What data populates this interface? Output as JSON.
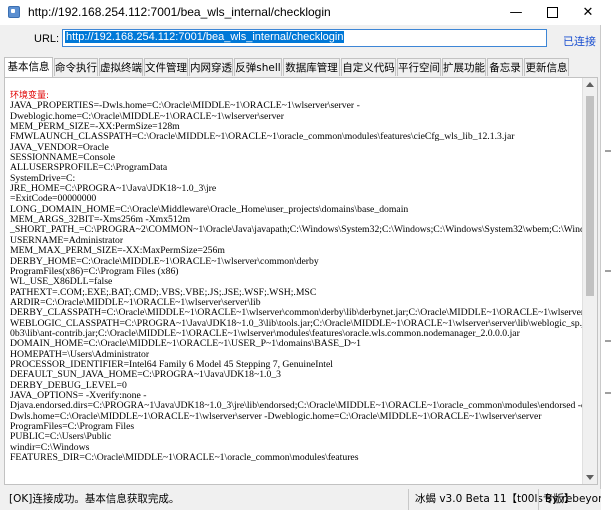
{
  "window": {
    "title": "http://192.168.254.112:7001/bea_wls_internal/checklogin",
    "minimize_glyph": "—",
    "close_glyph": "✕"
  },
  "url_bar": {
    "label": "URL:",
    "value": "http://192.168.254.112:7001/bea_wls_internal/checklogin",
    "status": "已连接"
  },
  "tabs": [
    {
      "label": "基本信息",
      "active": true
    },
    {
      "label": "命令执行",
      "active": false
    },
    {
      "label": "虚拟终端",
      "active": false
    },
    {
      "label": "文件管理",
      "active": false
    },
    {
      "label": "内网穿透",
      "active": false
    },
    {
      "label": "反弹shell",
      "active": false
    },
    {
      "label": "数据库管理",
      "active": false
    },
    {
      "label": "自定义代码",
      "active": false
    },
    {
      "label": "平行空间",
      "active": false
    },
    {
      "label": "扩展功能",
      "active": false
    },
    {
      "label": "备忘录",
      "active": false
    },
    {
      "label": "更新信息",
      "active": false
    }
  ],
  "content": {
    "section_header": "环境变量:",
    "lines": [
      "JAVA_PROPERTIES=-Dwls.home=C:\\Oracle\\MIDDLE~1\\ORACLE~1\\wlserver\\server -",
      "Dweblogic.home=C:\\Oracle\\MIDDLE~1\\ORACLE~1\\wlserver\\server",
      "MEM_PERM_SIZE=-XX:PermSize=128m",
      "FMWLAUNCH_CLASSPATH=C:\\Oracle\\MIDDLE~1\\ORACLE~1\\oracle_common\\modules\\features\\cieCfg_wls_lib_12.1.3.jar",
      "JAVA_VENDOR=Oracle",
      "SESSIONNAME=Console",
      "ALLUSERSPROFILE=C:\\ProgramData",
      "SystemDrive=C:",
      "JRE_HOME=C:\\PROGRA~1\\Java\\JDK18~1.0_3\\jre",
      "=ExitCode=00000000",
      "LONG_DOMAIN_HOME=C:\\Oracle\\Middleware\\Oracle_Home\\user_projects\\domains\\base_domain",
      "MEM_ARGS_32BIT=-Xms256m -Xmx512m",
      "_SHORT_PATH_=C:\\PROGRA~2\\COMMON~1\\Oracle\\Java\\javapath;C:\\Windows\\System32;C:\\Windows;C:\\Windows\\System32\\wbem;C:\\Windo",
      "USERNAME=Administrator",
      "MEM_MAX_PERM_SIZE=-XX:MaxPermSize=256m",
      "DERBY_HOME=C:\\Oracle\\MIDDLE~1\\ORACLE~1\\wlserver\\common\\derby",
      "ProgramFiles(x86)=C:\\Program Files (x86)",
      "WL_USE_X86DLL=false",
      "PATHEXT=.COM;.EXE;.BAT;.CMD;.VBS;.VBE;.JS;.JSE;.WSF;.WSH;.MSC",
      "ARDIR=C:\\Oracle\\MIDDLE~1\\ORACLE~1\\wlserver\\server\\lib",
      "DERBY_CLASSPATH=C:\\Oracle\\MIDDLE~1\\ORACLE~1\\wlserver\\common\\derby\\lib\\derbynet.jar;C:\\Oracle\\MIDDLE~1\\ORACLE~1\\wlserver\\cor",
      "WEBLOGIC_CLASSPATH=C:\\PROGRA~1\\Java\\JDK18~1.0_3\\lib\\tools.jar;C:\\Oracle\\MIDDLE~1\\ORACLE~1\\wlserver\\server\\lib\\weblogic_sp.jar;C",
      "0b3\\lib\\ant-contrib.jar;C:\\Oracle\\MIDDLE~1\\ORACLE~1\\wlserver\\modules\\features\\oracle.wls.common.nodemanager_2.0.0.0.jar",
      "DOMAIN_HOME=C:\\Oracle\\MIDDLE~1\\ORACLE~1\\USER_P~1\\domains\\BASE_D~1",
      "HOMEPATH=\\Users\\Administrator",
      "PROCESSOR_IDENTIFIER=Intel64 Family 6 Model 45 Stepping 7, GenuineIntel",
      "DEFAULT_SUN_JAVA_HOME=C:\\PROGRA~1\\Java\\JDK18~1.0_3",
      "DERBY_DEBUG_LEVEL=0",
      "JAVA_OPTIONS= -Xverify:none -",
      "Djava.endorsed.dirs=C:\\PROGRA~1\\Java\\JDK18~1.0_3\\jre\\lib\\endorsed;C:\\Oracle\\MIDDLE~1\\ORACLE~1\\oracle_common\\modules\\endorsed -da -",
      "Dwls.home=C:\\Oracle\\MIDDLE~1\\ORACLE~1\\wlserver\\server -Dweblogic.home=C:\\Oracle\\MIDDLE~1\\ORACLE~1\\wlserver\\server",
      "ProgramFiles=C:\\Program Files",
      "PUBLIC=C:\\Users\\Public",
      "windir=C:\\Windows",
      "FEATURES_DIR=C:\\Oracle\\MIDDLE~1\\ORACLE~1\\oracle_common\\modules\\features"
    ]
  },
  "statusbar": {
    "message": "[OK]连接成功。基本信息获取完成。",
    "version": "冰蝎 v3.0 Beta 11【t00ls专版】",
    "author": "By rebeyond"
  }
}
